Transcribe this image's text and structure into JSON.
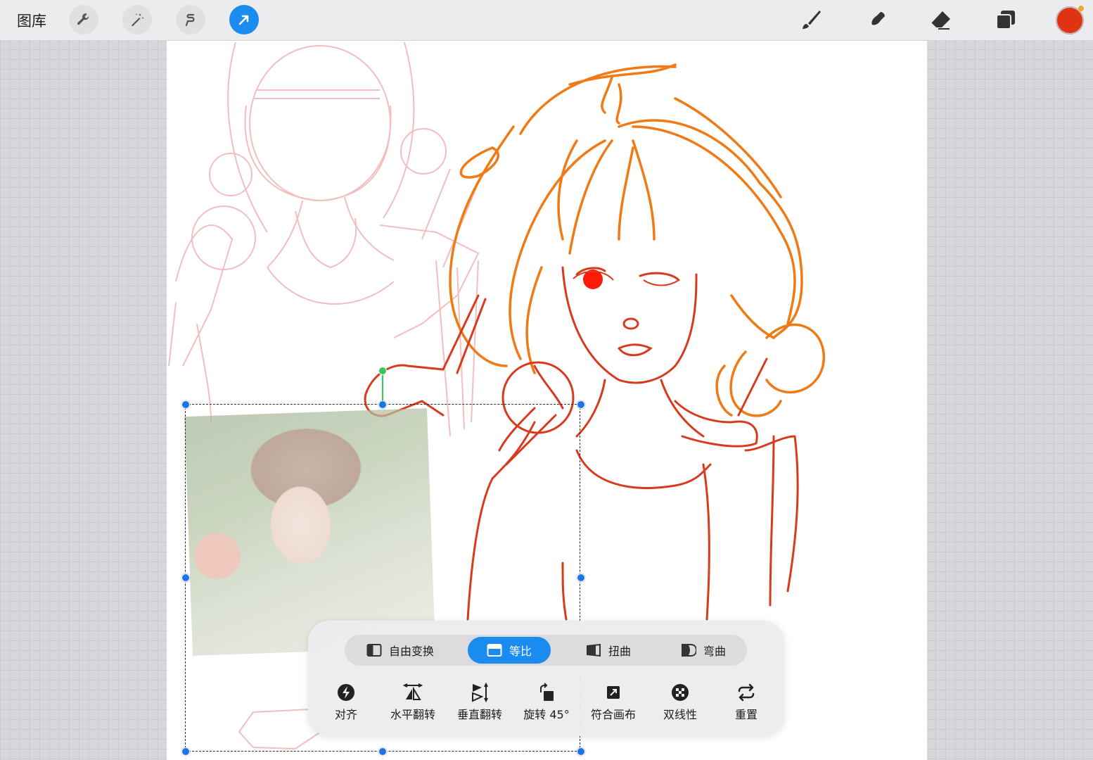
{
  "toolbar": {
    "gallery_label": "图库",
    "left_tools": [
      "wrench-icon",
      "magic-wand-icon",
      "selection-s-icon",
      "transform-arrow-icon"
    ],
    "active_tool": "transform-arrow-icon",
    "right_tools": [
      "brush-icon",
      "smudge-icon",
      "eraser-icon",
      "layers-icon"
    ],
    "current_color": "#e03314"
  },
  "transform_panel": {
    "modes": [
      {
        "label": "自由变换",
        "icon": "freeform-icon",
        "active": false
      },
      {
        "label": "等比",
        "icon": "uniform-icon",
        "active": true
      },
      {
        "label": "扭曲",
        "icon": "distort-icon",
        "active": false
      },
      {
        "label": "弯曲",
        "icon": "warp-icon",
        "active": false
      }
    ],
    "actions": [
      {
        "label": "对齐",
        "icon": "snap-icon"
      },
      {
        "label": "水平翻转",
        "icon": "flip-horizontal-icon"
      },
      {
        "label": "垂直翻转",
        "icon": "flip-vertical-icon"
      },
      {
        "label": "旋转 45°",
        "icon": "rotate-45-icon"
      },
      {
        "label": "符合画布",
        "icon": "fit-to-canvas-icon"
      },
      {
        "label": "双线性",
        "icon": "bilinear-icon"
      },
      {
        "label": "重置",
        "icon": "reset-icon"
      }
    ]
  },
  "colors": {
    "accent": "#1a8cf0",
    "sketch_pink": "#f2b7b7",
    "hair_orange": "#f07a14",
    "line_red": "#d83a1e",
    "eye_red": "#ff1a0a"
  }
}
